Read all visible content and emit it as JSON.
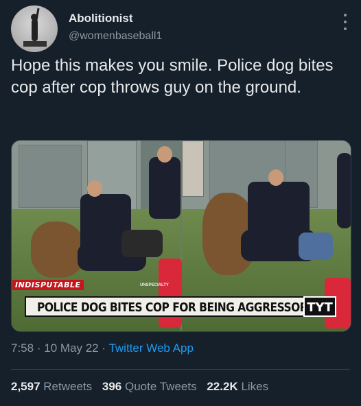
{
  "author": {
    "display_name": "Abolitionist",
    "handle": "@womenbaseball1"
  },
  "tweet": {
    "text": "Hope this makes you smile. Police dog bites cop after cop throws guy on the ground."
  },
  "media": {
    "chyron_tag": "INDISPUTABLE",
    "chyron_subtag": "UNSPECIALTY",
    "chyron_headline": "POLICE DOG BITES COP FOR BEING AGGRESSOR",
    "logo": "TYT"
  },
  "meta": {
    "time": "7:58",
    "date": "10 May 22",
    "separator": "·",
    "source": "Twitter Web App"
  },
  "stats": {
    "retweets_count": "2,597",
    "retweets_label": "Retweets",
    "quotes_count": "396",
    "quotes_label": "Quote Tweets",
    "likes_count": "22.2K",
    "likes_label": "Likes"
  },
  "icons": {
    "more": "more-vertical-icon"
  },
  "colors": {
    "background": "#15202b",
    "link": "#1d9bf0",
    "secondary_text": "#8b98a5"
  }
}
